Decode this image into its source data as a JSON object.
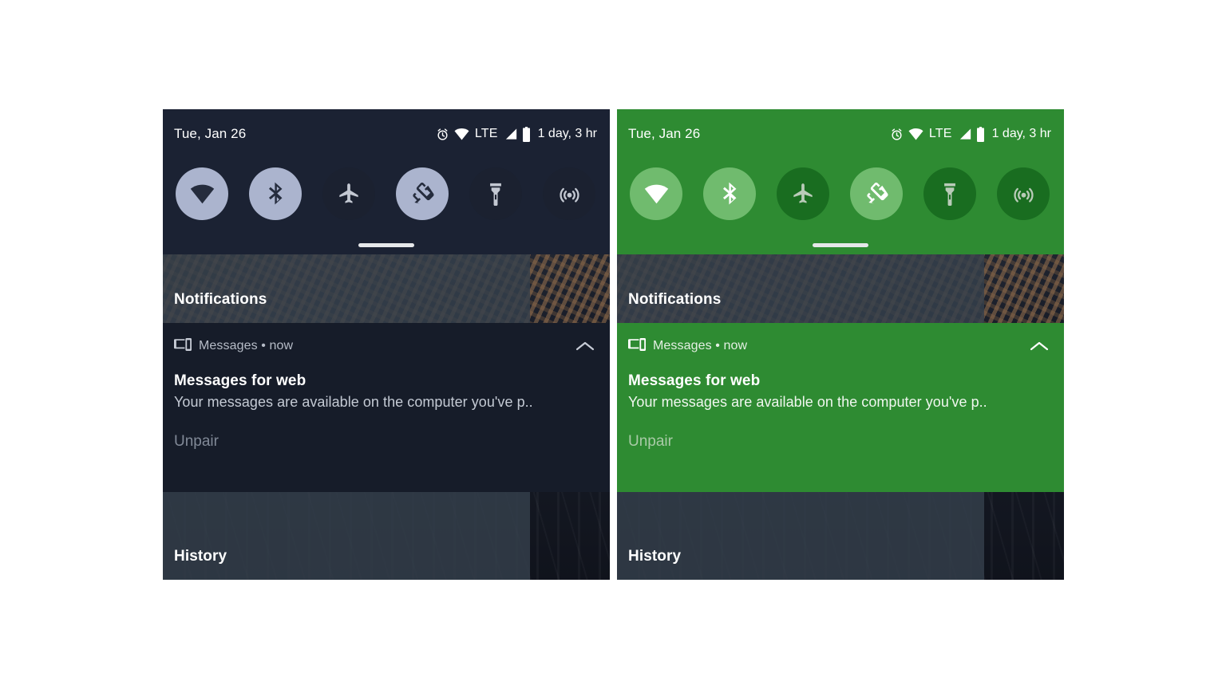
{
  "panels": [
    {
      "id": "dark",
      "theme_name": "dark-blue",
      "accent_color": "#abb4ce",
      "shade_bg": "#1b2233",
      "statusbar": {
        "date": "Tue, Jan 26",
        "alarm_icon": "alarm-clock-icon",
        "wifi_icon": "wifi-icon",
        "network_type": "LTE",
        "signal_icon": "cell-signal-icon",
        "battery_icon": "battery-icon",
        "battery_estimate": "1 day, 3 hr"
      },
      "tiles": [
        {
          "name": "wifi",
          "icon": "wifi-icon",
          "state": "on"
        },
        {
          "name": "bluetooth",
          "icon": "bluetooth-icon",
          "state": "on"
        },
        {
          "name": "airplane",
          "icon": "airplane-icon",
          "state": "off"
        },
        {
          "name": "auto-rotate",
          "icon": "auto-rotate-icon",
          "state": "on"
        },
        {
          "name": "flashlight",
          "icon": "flashlight-icon",
          "state": "off"
        },
        {
          "name": "hotspot",
          "icon": "hotspot-icon",
          "state": "off"
        }
      ],
      "sections": {
        "notifications_label": "Notifications",
        "history_label": "History"
      },
      "notification": {
        "app_icon": "devices-icon",
        "app_name": "Messages",
        "separator": "•",
        "time": "now",
        "header_line": "Messages • now",
        "title": "Messages for web",
        "body": "Your messages are available on the computer you've p..",
        "action_label": "Unpair",
        "collapse_icon": "chevron-up-icon"
      }
    },
    {
      "id": "green",
      "theme_name": "green",
      "accent_color": "#70bb6e",
      "shade_bg": "#2e8b32",
      "statusbar": {
        "date": "Tue, Jan 26",
        "alarm_icon": "alarm-clock-icon",
        "wifi_icon": "wifi-icon",
        "network_type": "LTE",
        "signal_icon": "cell-signal-icon",
        "battery_icon": "battery-icon",
        "battery_estimate": "1 day, 3 hr"
      },
      "tiles": [
        {
          "name": "wifi",
          "icon": "wifi-icon",
          "state": "on"
        },
        {
          "name": "bluetooth",
          "icon": "bluetooth-icon",
          "state": "on"
        },
        {
          "name": "airplane",
          "icon": "airplane-icon",
          "state": "off"
        },
        {
          "name": "auto-rotate",
          "icon": "auto-rotate-icon",
          "state": "on"
        },
        {
          "name": "flashlight",
          "icon": "flashlight-icon",
          "state": "off"
        },
        {
          "name": "hotspot",
          "icon": "hotspot-icon",
          "state": "off"
        }
      ],
      "sections": {
        "notifications_label": "Notifications",
        "history_label": "History"
      },
      "notification": {
        "app_icon": "devices-icon",
        "app_name": "Messages",
        "separator": "•",
        "time": "now",
        "header_line": "Messages • now",
        "title": "Messages for web",
        "body": "Your messages are available on the computer you've p..",
        "action_label": "Unpair",
        "collapse_icon": "chevron-up-icon"
      }
    }
  ]
}
